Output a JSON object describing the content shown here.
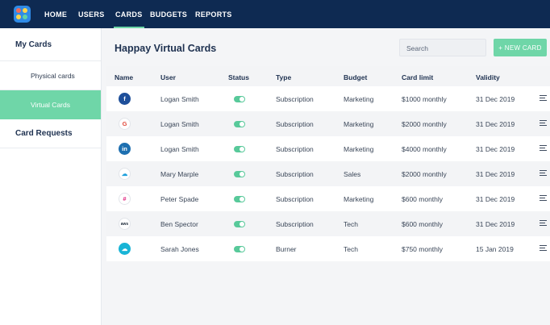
{
  "nav": {
    "items": [
      {
        "label": "HOME",
        "active": false
      },
      {
        "label": "USERS",
        "active": false
      },
      {
        "label": "CARDS",
        "active": true
      },
      {
        "label": "BUDGETS",
        "active": false
      },
      {
        "label": "REPORTS",
        "active": false
      }
    ]
  },
  "sidebar": {
    "items": [
      {
        "label": "My Cards",
        "kind": "heading"
      },
      {
        "label": "Physical cards",
        "kind": "sub"
      },
      {
        "label": "Virtual Cards",
        "kind": "sub",
        "selected": true
      },
      {
        "label": "Card Requests",
        "kind": "heading"
      }
    ]
  },
  "main": {
    "title": "Happay Virtual Cards",
    "search_placeholder": "Search",
    "new_card_label": "+ NEW CARD"
  },
  "table": {
    "columns": [
      "Name",
      "User",
      "Status",
      "Type",
      "Budget",
      "Card limit",
      "Validity"
    ],
    "rows": [
      {
        "icon": "facebook-icon",
        "user": "Logan Smith",
        "status": "on",
        "type": "Subscription",
        "budget": "Marketing",
        "limit": "$1000 monthly",
        "validity": "31 Dec 2019"
      },
      {
        "icon": "google-icon",
        "user": "Logan Smith",
        "status": "on",
        "type": "Subscription",
        "budget": "Marketing",
        "limit": "$2000 monthly",
        "validity": "31 Dec 2019"
      },
      {
        "icon": "linkedin-icon",
        "user": "Logan Smith",
        "status": "on",
        "type": "Subscription",
        "budget": "Marketing",
        "limit": "$4000 monthly",
        "validity": "31 Dec 2019"
      },
      {
        "icon": "salesforce-icon",
        "user": "Mary Marple",
        "status": "on",
        "type": "Subscription",
        "budget": "Sales",
        "limit": "$2000 monthly",
        "validity": "31 Dec 2019"
      },
      {
        "icon": "slack-icon",
        "user": "Peter Spade",
        "status": "on",
        "type": "Subscription",
        "budget": "Marketing",
        "limit": "$600 monthly",
        "validity": "31 Dec 2019"
      },
      {
        "icon": "aws-icon",
        "user": "Ben Spector",
        "status": "on",
        "type": "Subscription",
        "budget": "Tech",
        "limit": "$600 monthly",
        "validity": "31 Dec 2019"
      },
      {
        "icon": "cloud-icon",
        "user": "Sarah Jones",
        "status": "on",
        "type": "Burner",
        "budget": "Tech",
        "limit": "$750 monthly",
        "validity": "15 Jan 2019"
      }
    ]
  },
  "colors": {
    "topbar": "#0e2a52",
    "accent": "#6fd6a8",
    "toggle_on": "#58c99a"
  }
}
